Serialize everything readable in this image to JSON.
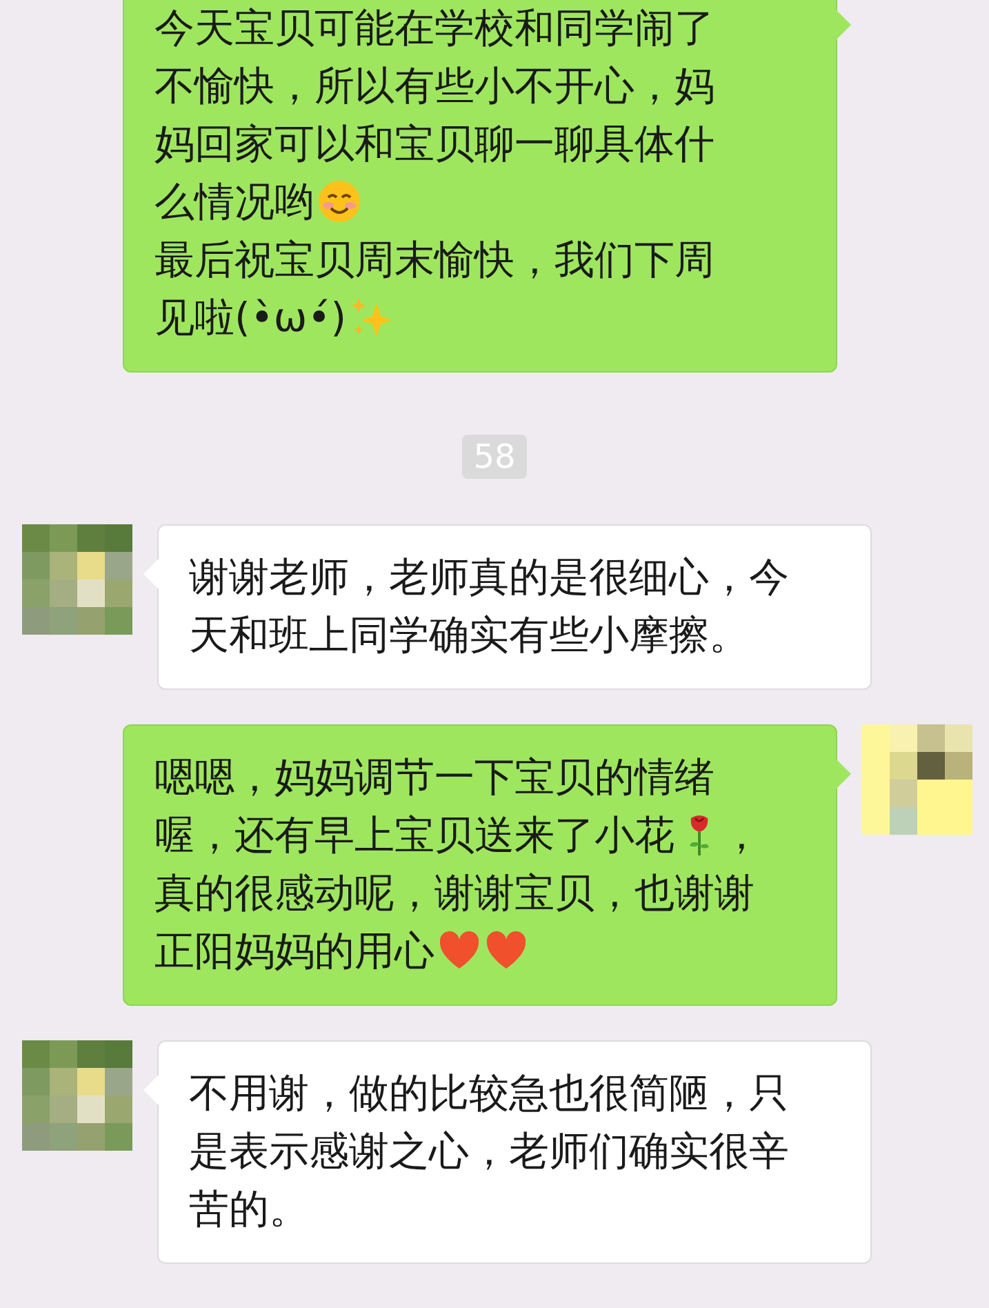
{
  "messages": [
    {
      "kind": "sent",
      "lines": [
        [
          {
            "kind": "text",
            "text": "今天宝贝可能在学校和同学闹了"
          }
        ],
        [
          {
            "kind": "text",
            "text": "不愉快，所以有些小不开心，妈"
          }
        ],
        [
          {
            "kind": "text",
            "text": "妈回家可以和宝贝聊一聊具体什"
          }
        ],
        [
          {
            "kind": "text",
            "text": "么情况哟"
          },
          {
            "kind": "smile"
          }
        ],
        [
          {
            "kind": "text",
            "text": "最后祝宝贝周末愉快，我们下周"
          }
        ],
        [
          {
            "kind": "text",
            "text": "见啦(•̀ω•́)"
          },
          {
            "kind": "sparkle"
          }
        ]
      ]
    },
    {
      "kind": "time",
      "text": "58"
    },
    {
      "kind": "received",
      "lines": [
        [
          {
            "kind": "text",
            "text": "谢谢老师，老师真的是很细心，今"
          }
        ],
        [
          {
            "kind": "text",
            "text": "天和班上同学确实有些小摩擦。"
          }
        ]
      ]
    },
    {
      "kind": "sent",
      "lines": [
        [
          {
            "kind": "text",
            "text": "嗯嗯，妈妈调节一下宝贝的情绪"
          }
        ],
        [
          {
            "kind": "text",
            "text": "喔，还有早上宝贝送来了小花"
          },
          {
            "kind": "rose"
          },
          {
            "kind": "text",
            "text": "，"
          }
        ],
        [
          {
            "kind": "text",
            "text": "真的很感动呢，谢谢宝贝，也谢谢"
          }
        ],
        [
          {
            "kind": "text",
            "text": "正阳妈妈的用心"
          },
          {
            "kind": "heart"
          },
          {
            "kind": "heart"
          }
        ]
      ]
    },
    {
      "kind": "received",
      "lines": [
        [
          {
            "kind": "text",
            "text": "不用谢，做的比较急也很简陋，只"
          }
        ],
        [
          {
            "kind": "text",
            "text": "是表示感谢之心，老师们确实很辛"
          }
        ],
        [
          {
            "kind": "text",
            "text": "苦的。"
          }
        ]
      ]
    }
  ]
}
